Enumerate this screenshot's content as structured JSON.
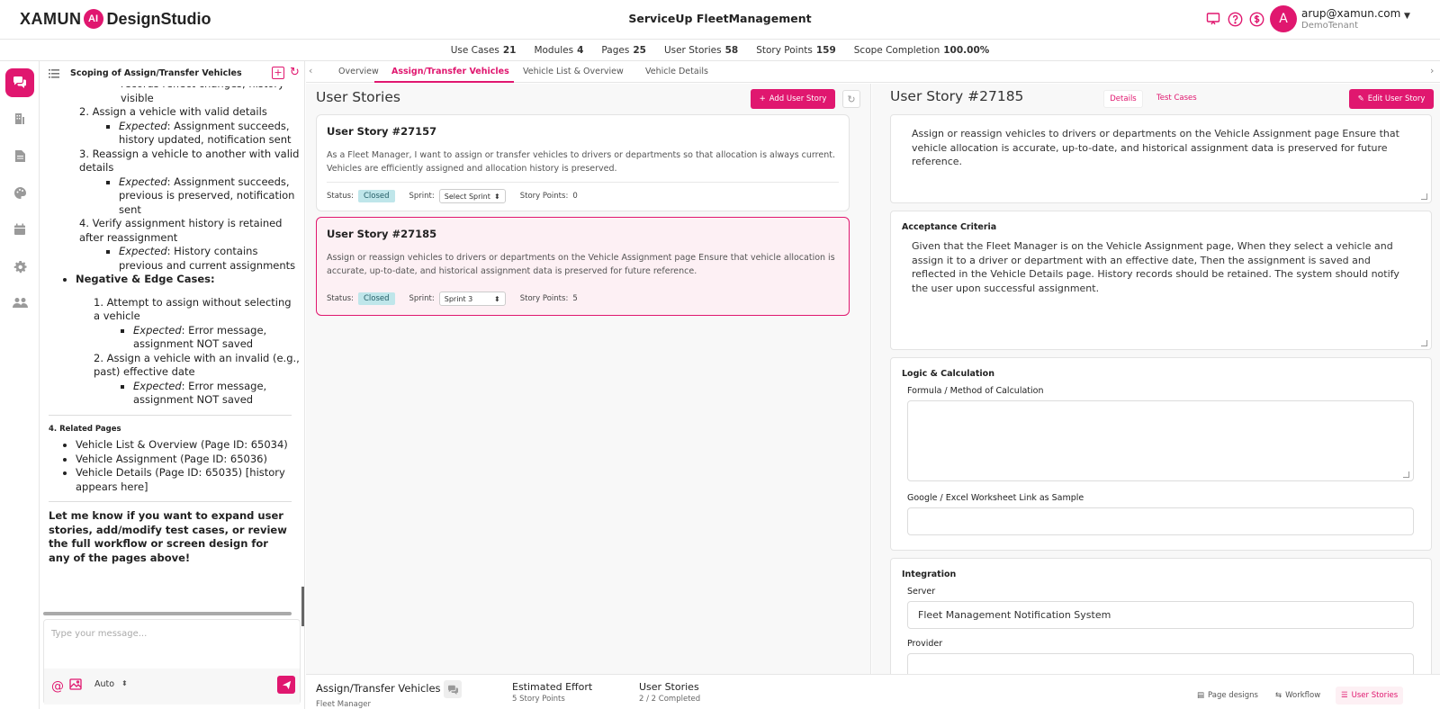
{
  "header": {
    "logo_xamun": "XAMUN",
    "logo_ai": "AI",
    "logo_ds": "DesignStudio",
    "app_title": "ServiceUp FleetManagement",
    "user_initial": "A",
    "user_email": "arup@xamun.com",
    "user_tenant": "DemoTenant",
    "icons": [
      "presentation-icon",
      "help-icon",
      "billing-icon"
    ]
  },
  "stats": [
    {
      "label": "Use Cases",
      "value": "21"
    },
    {
      "label": "Modules",
      "value": "4"
    },
    {
      "label": "Pages",
      "value": "25"
    },
    {
      "label": "User Stories",
      "value": "58"
    },
    {
      "label": "Story Points",
      "value": "159"
    },
    {
      "label": "Scope Completion",
      "value": "100.00%"
    }
  ],
  "rail": [
    "chat-icon",
    "building-icon",
    "document-icon",
    "palette-icon",
    "calendar-icon",
    "settings-icon",
    "team-icon"
  ],
  "chat": {
    "title": "Scoping of Assign/Transfer Vehicles",
    "partial_top": "records reflect changes, history visible",
    "positive": [
      {
        "num": "2.",
        "text": "Assign a vehicle with valid details",
        "expected_label": "Expected",
        "expected": ": Assignment succeeds, history updated, notification sent"
      },
      {
        "num": "3.",
        "text": "Reassign a vehicle to another with valid details",
        "expected_label": "Expected",
        "expected": ": Assignment succeeds, previous is preserved, notification sent"
      },
      {
        "num": "4.",
        "text": "Verify assignment history is retained after reassignment",
        "expected_label": "Expected",
        "expected": ": History contains previous and current assignments"
      }
    ],
    "negative_heading": "Negative & Edge Cases:",
    "negative": [
      {
        "num": "1.",
        "text": "Attempt to assign without selecting a vehicle",
        "expected_label": "Expected",
        "expected": ": Error message, assignment NOT saved"
      },
      {
        "num": "2.",
        "text": "Assign a vehicle with an invalid (e.g., past) effective date",
        "expected_label": "Expected",
        "expected": ": Error message, assignment NOT saved"
      }
    ],
    "related_title": "4. Related Pages",
    "related": [
      "Vehicle List & Overview (Page ID: 65034)",
      "Vehicle Assignment (Page ID: 65036)",
      "Vehicle Details (Page ID: 65035) [history appears here]"
    ],
    "closing": "Let me know if you want to expand user stories, add/modify test cases, or review the full workflow or screen design for any of the pages above!",
    "input_placeholder": "Type your message...",
    "mode": "Auto"
  },
  "tabs": [
    "Overview",
    "Assign/Transfer Vehicles",
    "Vehicle List & Overview",
    "Vehicle Details"
  ],
  "active_tab": "Assign/Transfer Vehicles",
  "stories_panel": {
    "title": "User Stories",
    "add_label": "Add User Story",
    "stories": [
      {
        "title": "User Story #27157",
        "desc": "As a Fleet Manager, I want to assign or transfer vehicles to drivers or departments so that allocation is always current. Vehicles are efficiently assigned and allocation history is preserved.",
        "status_label": "Status:",
        "status": "Closed",
        "sprint_label": "Sprint:",
        "sprint": "Select Sprint",
        "points_label": "Story Points:",
        "points": "0"
      },
      {
        "title": "User Story #27185",
        "desc": "Assign or reassign vehicles to drivers or departments on the Vehicle Assignment page Ensure that vehicle allocation is accurate, up-to-date, and historical assignment data is preserved for future reference.",
        "status_label": "Status:",
        "status": "Closed",
        "sprint_label": "Sprint:",
        "sprint": "Sprint 3",
        "points_label": "Story Points:",
        "points": "5"
      }
    ]
  },
  "detail": {
    "title": "User Story #27185",
    "tab_details": "Details",
    "tab_tests": "Test Cases",
    "edit_label": "Edit User Story",
    "description": "Assign or reassign vehicles to drivers or departments on the Vehicle Assignment page Ensure that vehicle allocation is accurate, up-to-date, and historical assignment data is preserved for future reference.",
    "acceptance_heading": "Acceptance Criteria",
    "acceptance": "Given that the Fleet Manager is on the Vehicle Assignment page, When they select a vehicle and assign it to a driver or department with an effective date, Then the assignment is saved and reflected in the Vehicle Details page. History records should be retained. The system should notify the user upon successful assignment.",
    "logic_heading": "Logic & Calculation",
    "formula_label": "Formula / Method of Calculation",
    "formula_value": "",
    "sheet_label": "Google / Excel Worksheet Link as Sample",
    "sheet_value": "",
    "integration_heading": "Integration",
    "server_label": "Server",
    "server_value": "Fleet Management Notification System",
    "provider_label": "Provider",
    "provider_value": ""
  },
  "footer": {
    "page_name": "Assign/Transfer Vehicles",
    "role": "Fleet Manager",
    "effort_label": "Estimated Effort",
    "effort_value": "5 Story Points",
    "stories_label": "User Stories",
    "stories_value": "2 / 2 Completed",
    "btn_designs": "Page designs",
    "btn_workflow": "Workflow",
    "btn_stories": "User Stories"
  },
  "colors": {
    "accent": "#e0176f",
    "badge_bg": "#bfe6ea",
    "selected_bg": "#fdf0f4"
  }
}
